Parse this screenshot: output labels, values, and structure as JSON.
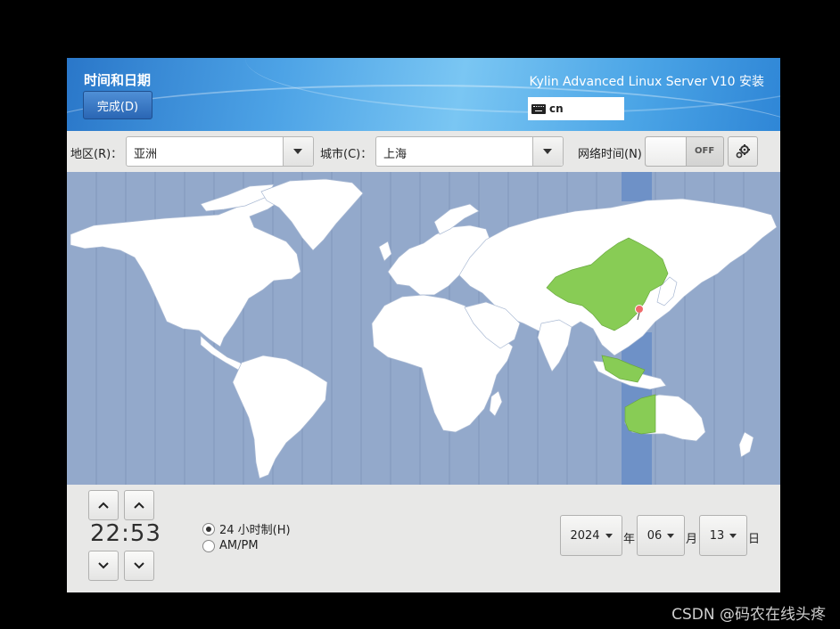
{
  "header": {
    "spoke_title": "时间和日期",
    "done_label": "完成(D)",
    "product": "Kylin Advanced Linux Server V10 安装",
    "keyboard_layout": "cn"
  },
  "selectors": {
    "region_label": "地区(R)：",
    "region_value": "亚洲",
    "city_label": "城市(C)：",
    "city_value": "上海",
    "ntp_label": "网络时间(N)",
    "ntp_state": "OFF"
  },
  "map": {
    "ocean_color": "#93a9cb",
    "land_color": "#ffffff",
    "selected_zone_color": "#88cc55",
    "timezone_band_color": "#6e91c7",
    "marker_color": "#ef6b6b"
  },
  "time": {
    "clock": "22:53",
    "format_24h_label": "24 小时制(H)",
    "format_ampm_label": "AM/PM",
    "format_selected": "24h"
  },
  "date": {
    "year": "2024",
    "year_unit": "年",
    "month": "06",
    "month_unit": "月",
    "day": "13",
    "day_unit": "日"
  },
  "watermark": "CSDN @码农在线头疼"
}
